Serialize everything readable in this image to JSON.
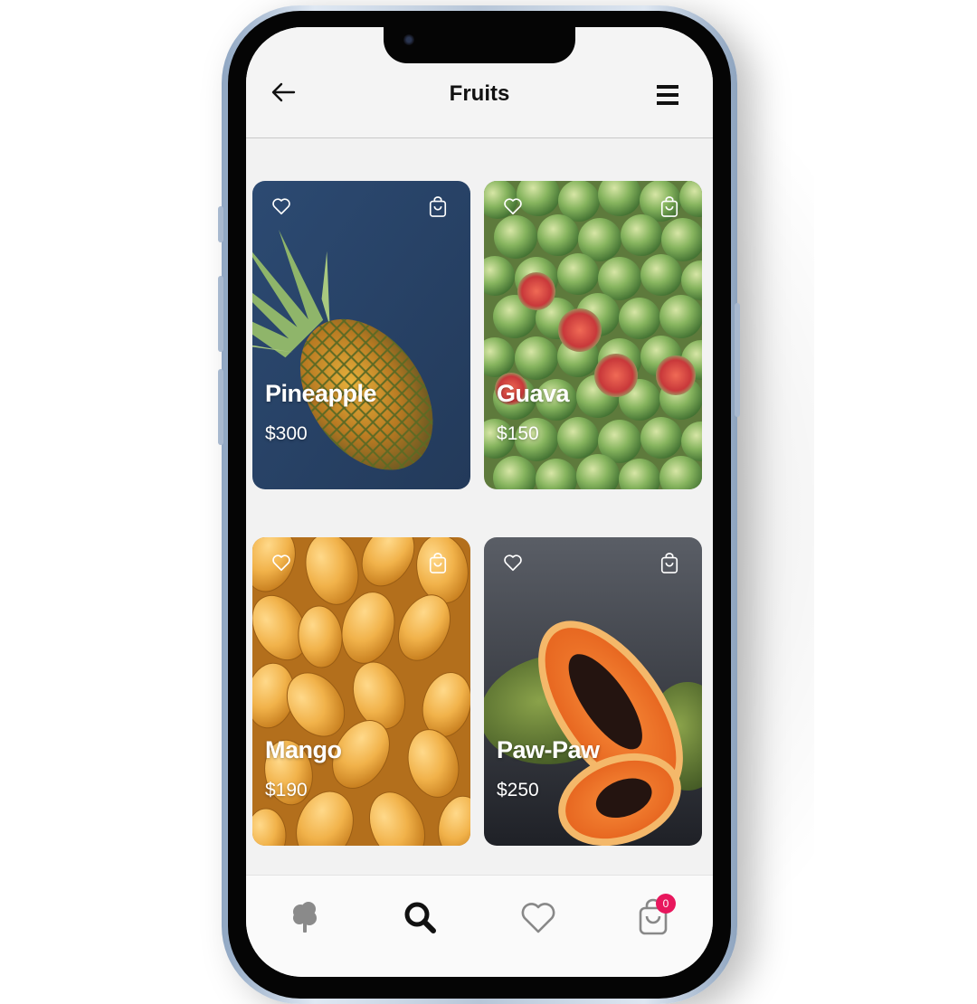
{
  "app": {
    "title": "Fruits"
  },
  "header": {
    "back_icon": "arrow-left-icon",
    "menu_icon": "hamburger-menu-icon"
  },
  "products": [
    {
      "name": "Pineapple",
      "price": "$300",
      "image": "pineapple-photo"
    },
    {
      "name": "Guava",
      "price": "$150",
      "image": "guava-photo"
    },
    {
      "name": "Mango",
      "price": "$190",
      "image": "mango-photo"
    },
    {
      "name": "Paw-Paw",
      "price": "$250",
      "image": "papaya-photo"
    }
  ],
  "card_icons": {
    "favorite": "heart-outline-icon",
    "cart": "shopping-bag-icon"
  },
  "bottom_nav": {
    "items": [
      {
        "icon": "tree-icon",
        "active": false
      },
      {
        "icon": "search-icon",
        "active": true
      },
      {
        "icon": "heart-outline-icon",
        "active": false
      },
      {
        "icon": "shopping-bag-icon",
        "active": false,
        "badge": "0"
      }
    ]
  },
  "colors": {
    "badge": "#e8175d",
    "header_bg": "#f4f4f4",
    "screen_bg": "#f2f2f2",
    "pineapple_bg": "#2f4a6e"
  }
}
